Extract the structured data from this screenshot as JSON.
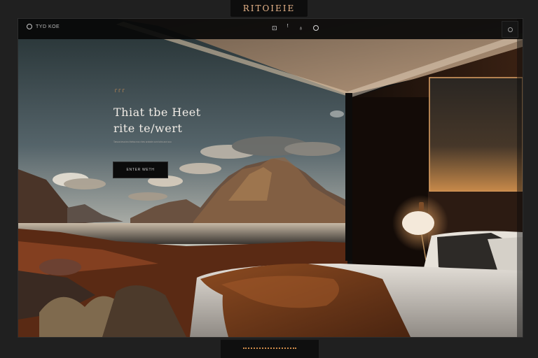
{
  "window": {
    "title": "RITOIEIE"
  },
  "nav": {
    "brand": "TYD KOE",
    "icons": [
      "logo-ring-icon",
      "tag-icon",
      "pin-icon",
      "paint-drop-icon",
      "circle-icon",
      "search-icon"
    ]
  },
  "hero": {
    "eyebrow": "ΓΓΓ",
    "title_line1": "Thiat tbe  Heet",
    "title_line2": "rite  te/wert",
    "subtitle": "Tarsoa tesa teo thetsa eos vhes arotwte oorn tohs aon soo",
    "cta_label": "ENTER WETH"
  },
  "colors": {
    "accent": "#d18d4b",
    "frame_bg": "#202020",
    "nav_bg": "#080808"
  }
}
